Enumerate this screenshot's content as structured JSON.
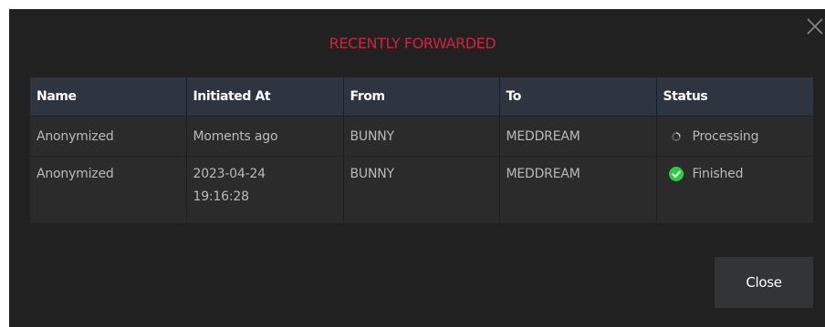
{
  "dialog": {
    "title": "RECENTLY FORWARDED",
    "close_icon": "close-x-icon",
    "close_button_label": "Close"
  },
  "table": {
    "columns": [
      "Name",
      "Initiated At",
      "From",
      "To",
      "Status"
    ],
    "rows": [
      {
        "name": "Anonymized",
        "initiated_at": "Moments ago",
        "from": "BUNNY",
        "to": "MEDDREAM",
        "status": "Processing",
        "status_icon": "spinner-icon"
      },
      {
        "name": "Anonymized",
        "initiated_at": "2023-04-24 19:16:28",
        "from": "BUNNY",
        "to": "MEDDREAM",
        "status": "Finished",
        "status_icon": "check-circle-icon"
      }
    ]
  },
  "colors": {
    "title": "#d2213e",
    "success": "#2ecc40",
    "dialog_bg": "#212121",
    "header_bg": "#2d3540"
  }
}
